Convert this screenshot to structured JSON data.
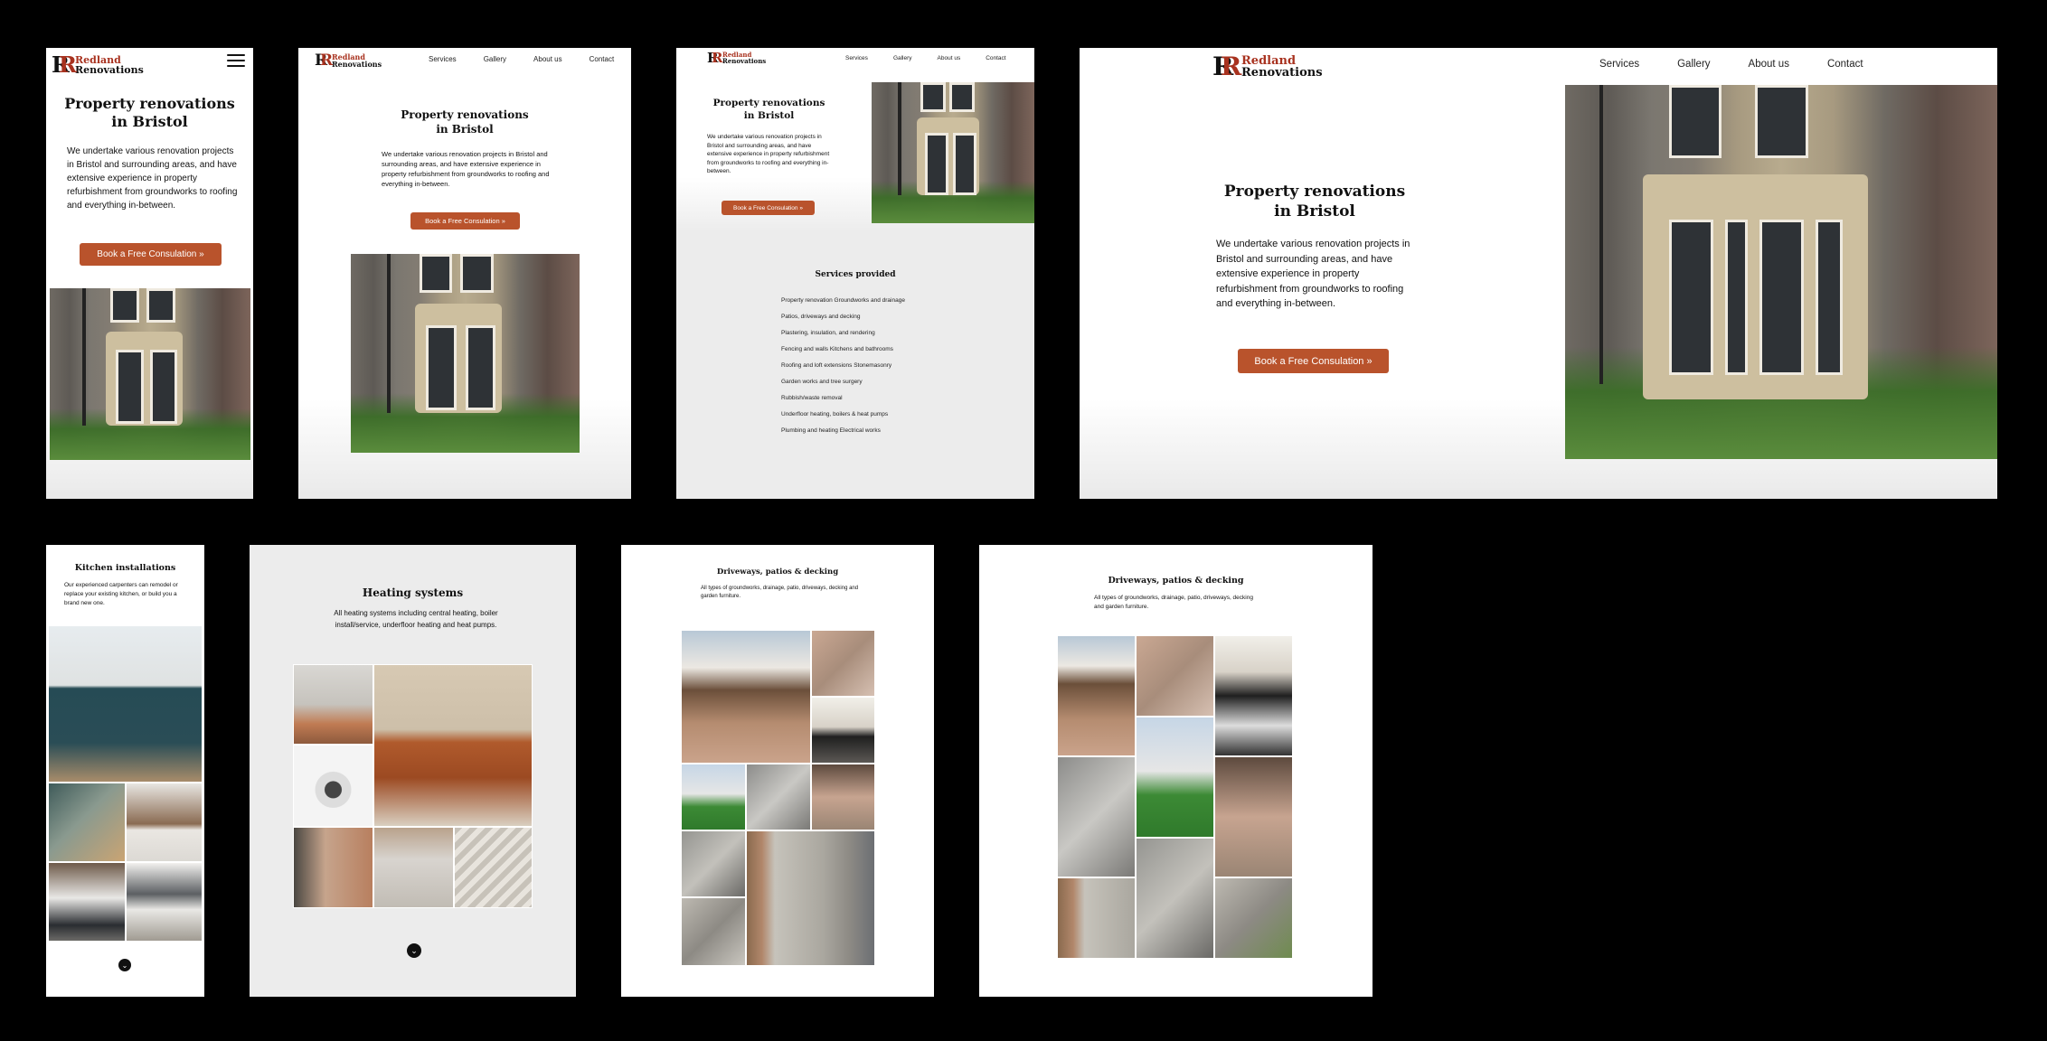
{
  "brand": {
    "line1": "Redland",
    "line2": "Renovations",
    "mark": "R"
  },
  "nav": [
    "Services",
    "Gallery",
    "About us",
    "Contact"
  ],
  "hero": {
    "title_line1": "Property renovations",
    "title_line2": "in Bristol",
    "paragraph": "We undertake various renovation projects in Bristol and surrounding areas, and have extensive experience in property refurbishment from groundworks to roofing and everything in-between.",
    "cta": "Book a Free Consulation",
    "cta_icon": "double-chevron-right-icon"
  },
  "services": {
    "heading": "Services provided",
    "items": [
      "Property renovation Groundworks and drainage",
      "Patios, driveways and decking",
      "Plastering, insulation, and rendering",
      "Fencing and walls Kitchens and bathrooms",
      "Roofing and loft extensions Stonemasonry",
      "Garden works and tree surgery",
      "Rubbish/waste removal",
      "Underfloor heating, boilers & heat pumps",
      "Plumbing and heating Electrical works"
    ]
  },
  "kitchen": {
    "title": "Kitchen installations",
    "paragraph": "Our experienced carpenters can remodel or replace your existing kitchen, or build you a brand new one."
  },
  "heating": {
    "title": "Heating systems",
    "paragraph": "All heating systems including central heating, boiler install/service, underfloor heating and heat pumps."
  },
  "driveways": {
    "title": "Driveways, patios & decking",
    "paragraph": "All types of groundworks, drainage, patio, driveways, decking and garden furniture."
  },
  "icons": {
    "menu": "hamburger-menu-icon",
    "scroll": "chevron-down-icon"
  },
  "colors": {
    "accent": "#b9532c",
    "brand_red": "#a8321f",
    "background": "#000000"
  }
}
